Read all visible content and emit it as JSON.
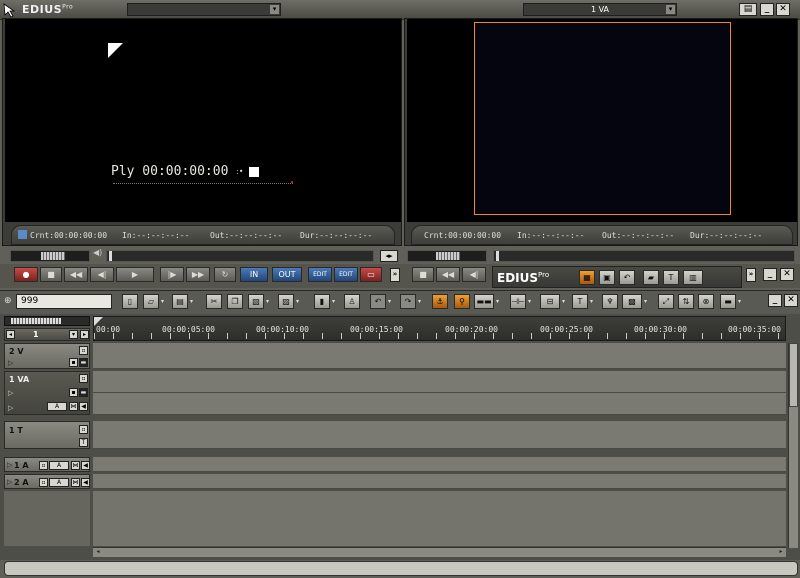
{
  "app": {
    "logo": "EDIUS",
    "logo_sup": "Pro"
  },
  "titlebar": {
    "left_combo": "",
    "right_combo": "1 VA"
  },
  "player": {
    "overlay_tc": "Ply 00:00:00:00",
    "crnt": "Crnt:00:00:00:00",
    "in": "In:--:--:--:--",
    "out": "Out:--:--:--:--",
    "dur": "Dur:--:--:--:--"
  },
  "recorder": {
    "crnt": "Crnt:00:00:00:00",
    "in": "In:--:--:--:--",
    "out": "Out:--:--:--:--",
    "dur": "Dur:--:--:--:--"
  },
  "transport": {
    "in_label": "IN",
    "out_label": "OUT",
    "edit_label": "EDIT"
  },
  "sequence": {
    "name": "999",
    "dock_logo": "EDIUS",
    "dock_logo_sup": "Pro"
  },
  "timeline": {
    "ruler": [
      "00:00",
      "00:00:05:00",
      "00:00:10:00",
      "00:00:15:00",
      "00:00:20:00",
      "00:00:25:00",
      "00:00:30:00",
      "00:00:35:00"
    ],
    "page": "1",
    "tracks": [
      {
        "label": "2 V"
      },
      {
        "label": "1 VA"
      },
      {
        "label": "1 T"
      },
      {
        "label": "1 A"
      },
      {
        "label": "2 A"
      }
    ]
  },
  "colors": {
    "accent": "#f08a20",
    "frame": "#3c3c38"
  }
}
